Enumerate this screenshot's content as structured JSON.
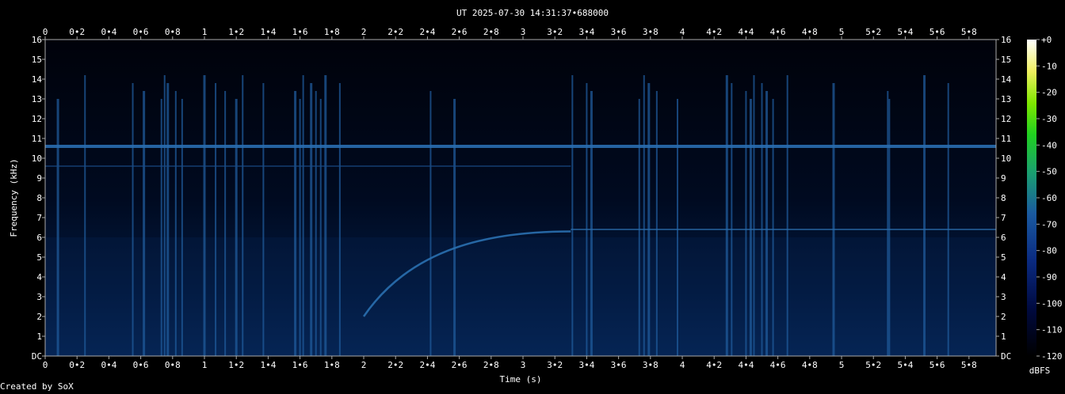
{
  "chart_data": {
    "type": "heatmap",
    "title": "UT 2025-07-30 14:31:37•688000",
    "xlabel": "Time (s)",
    "ylabel": "Frequency (kHz)",
    "x_ticks": [
      "0",
      "0•2",
      "0•4",
      "0•6",
      "0•8",
      "1",
      "1•2",
      "1•4",
      "1•6",
      "1•8",
      "2",
      "2•2",
      "2•4",
      "2•6",
      "2•8",
      "3",
      "3•2",
      "3•4",
      "3•6",
      "3•8",
      "4",
      "4•2",
      "4•4",
      "4•6",
      "4•8",
      "5",
      "5•2",
      "5•4",
      "5•6",
      "5•8"
    ],
    "y_ticks": [
      "DC",
      "1",
      "2",
      "3",
      "4",
      "5",
      "6",
      "7",
      "8",
      "9",
      "10",
      "11",
      "12",
      "13",
      "14",
      "15",
      "16"
    ],
    "xlim": [
      0,
      5.97
    ],
    "ylim": [
      0,
      16
    ],
    "colorbar": {
      "label": "dBFS",
      "ticks": [
        "+0",
        "-10",
        "-20",
        "-30",
        "-40",
        "-50",
        "-60",
        "-70",
        "-80",
        "-90",
        "-100",
        "-110",
        "-120"
      ],
      "range": [
        -120,
        0
      ]
    },
    "features": {
      "tone_khz": 10.6,
      "faint_tone_khz": 9.6,
      "sweep": {
        "start_s": 2.0,
        "start_khz": 2.0,
        "end_s": 3.3,
        "end_khz": 6.3
      },
      "high_tone_khz": 6.4,
      "impulse_times_s": [
        0.08,
        0.25,
        0.55,
        0.62,
        0.73,
        0.75,
        0.77,
        0.82,
        0.86,
        1.0,
        1.07,
        1.13,
        1.2,
        1.24,
        1.37,
        1.57,
        1.6,
        1.62,
        1.67,
        1.7,
        1.73,
        1.76,
        1.85,
        2.42,
        2.57,
        3.31,
        3.4,
        3.43,
        3.73,
        3.76,
        3.79,
        3.84,
        3.97,
        4.28,
        4.31,
        4.4,
        4.43,
        4.45,
        4.5,
        4.53,
        4.57,
        4.66,
        4.95,
        5.29,
        5.3,
        5.52,
        5.67
      ]
    }
  },
  "footer": {
    "credit": "Created by SoX"
  }
}
